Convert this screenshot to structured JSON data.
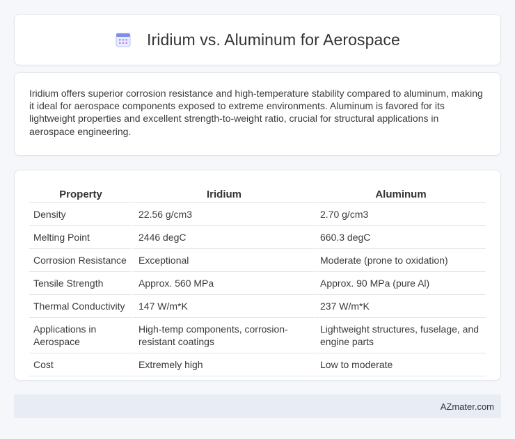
{
  "header": {
    "title": "Iridium vs. Aluminum for Aerospace",
    "icon": "calendar-icon"
  },
  "intro": {
    "text": "Iridium offers superior corrosion resistance and high-temperature stability compared to aluminum, making it ideal for aerospace components exposed to extreme environments. Aluminum is favored for its lightweight properties and excellent strength-to-weight ratio, crucial for structural applications in aerospace engineering."
  },
  "table": {
    "headers": [
      "Property",
      "Iridium",
      "Aluminum"
    ],
    "rows": [
      [
        "Density",
        "22.56 g/cm3",
        "2.70 g/cm3"
      ],
      [
        "Melting Point",
        "2446 degC",
        "660.3 degC"
      ],
      [
        "Corrosion Resistance",
        "Exceptional",
        "Moderate (prone to oxidation)"
      ],
      [
        "Tensile Strength",
        "Approx. 560 MPa",
        "Approx. 90 MPa (pure Al)"
      ],
      [
        "Thermal Conductivity",
        "147 W/m*K",
        "237 W/m*K"
      ],
      [
        "Applications in Aerospace",
        "High-temp components, corrosion-resistant coatings",
        "Lightweight structures, fuselage, and engine parts"
      ],
      [
        "Cost",
        "Extremely high",
        "Low to moderate"
      ]
    ]
  },
  "footer": {
    "brand": "AZmater.com"
  },
  "colors": {
    "page_background": "#f5f7fa",
    "footer_background": "#e8edf5",
    "icon_accent": "#6b7fe0"
  }
}
